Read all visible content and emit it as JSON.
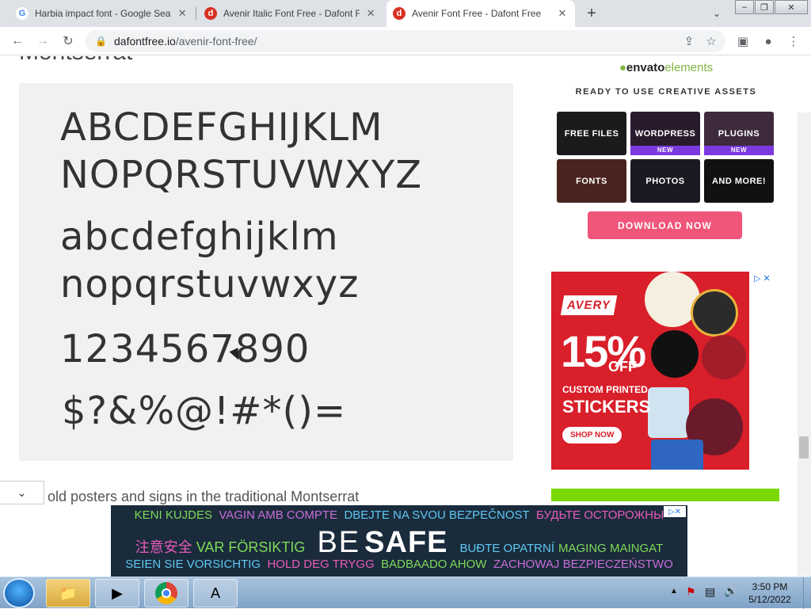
{
  "browser": {
    "tabs": [
      {
        "title": "Harbia impact font - Google Search",
        "favicon": "google-icon",
        "active": false
      },
      {
        "title": "Avenir Italic Font Free - Dafont Free",
        "favicon": "dafont-icon",
        "active": false
      },
      {
        "title": "Avenir Font Free - Dafont Free",
        "favicon": "dafont-icon",
        "active": true
      }
    ],
    "url_domain": "dafontfree.io",
    "url_path": "/avenir-font-free/"
  },
  "page": {
    "cutoff_heading": "Montserrat",
    "preview": {
      "uppercase_line1": "ABCDEFGHIJKLM",
      "uppercase_line2": "NOPQRSTUVWXYZ",
      "lowercase_line1": "abcdefghijklm",
      "lowercase_line2": "nopqrstuvwxyz",
      "numbers": "1234567890",
      "symbols": "$?&%@!#*()="
    },
    "body_text": "old posters and signs in the traditional Montserrat"
  },
  "sidebar": {
    "envato": {
      "logo_prefix": "envato",
      "logo_suffix": "elements",
      "tagline": "READY TO USE CREATIVE ASSETS",
      "tiles": [
        {
          "label": "FREE FILES",
          "badge": ""
        },
        {
          "label": "WORDPRESS",
          "badge": "NEW"
        },
        {
          "label": "PLUGINS",
          "badge": "NEW"
        },
        {
          "label": "FONTS",
          "badge": ""
        },
        {
          "label": "PHOTOS",
          "badge": ""
        },
        {
          "label": "AND MORE!",
          "badge": ""
        }
      ],
      "download_label": "DOWNLOAD NOW"
    },
    "avery_ad": {
      "brand": "AVERY",
      "percent": "15%",
      "off": "OFF",
      "subline": "CUSTOM PRINTED",
      "headline": "STICKERS",
      "cta": "SHOP NOW"
    }
  },
  "bottom_ad": {
    "row1": [
      {
        "text": "KENI KUJDES",
        "color": "#7ed957"
      },
      {
        "text": "VAGIN AMB COMPTE",
        "color": "#c86dd7"
      },
      {
        "text": "DBEJTE NA SVOU BEZPEČNOST",
        "color": "#5ec8f2"
      },
      {
        "text": "БУДЬТЕ ОСТОРОЖНЫ",
        "color": "#e85bb8"
      }
    ],
    "row2": [
      {
        "text": "注意安全",
        "color": "#e85bb8"
      },
      {
        "text": "VAR FÖRSIKTIG",
        "color": "#7ed957"
      },
      {
        "text": "BE",
        "color": "#ffffff"
      },
      {
        "text": "SAFE",
        "color": "#ffffff"
      },
      {
        "text": "BUĐTE OPATRNÍ",
        "color": "#5ec8f2"
      },
      {
        "text": "MAGING MAINGAT",
        "color": "#7ed957"
      }
    ],
    "row3": [
      {
        "text": "SEIEN SIE VORSICHTIG",
        "color": "#5ec8f2"
      },
      {
        "text": "HOLD DEG TRYGG",
        "color": "#e85bb8"
      },
      {
        "text": "BADBAADO AHOW",
        "color": "#7ed957"
      },
      {
        "text": "ZACHOWAJ BEZPIECZEŃSTWO",
        "color": "#c86dd7"
      }
    ]
  },
  "taskbar": {
    "time": "3:50 PM",
    "date": "5/12/2022"
  }
}
